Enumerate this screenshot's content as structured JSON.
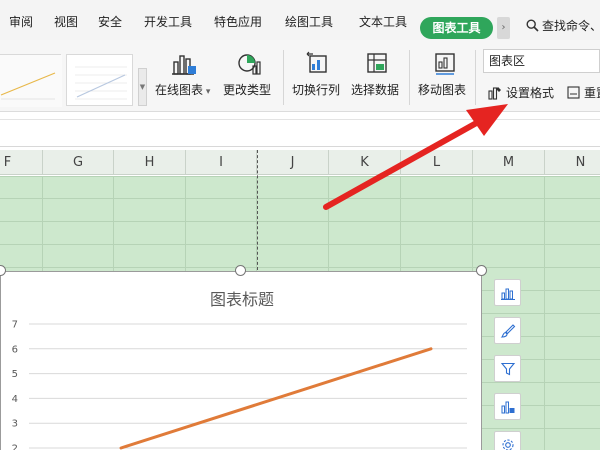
{
  "menu": {
    "tabs": [
      "审阅",
      "视图",
      "安全",
      "开发工具",
      "特色应用",
      "绘图工具",
      "文本工具"
    ],
    "active_tab": "图表工具",
    "search": "查找命令、"
  },
  "ribbon": {
    "online_chart": "在线图表",
    "change_type": "更改类型",
    "switch_row_col": "切换行列",
    "select_data": "选择数据",
    "move_chart": "移动图表",
    "chart_element_select": "图表区",
    "set_format": "设置格式",
    "reset": "重置"
  },
  "sheet": {
    "columns": [
      "F",
      "G",
      "H",
      "I",
      "J",
      "K",
      "L",
      "M",
      "N"
    ]
  },
  "chart": {
    "title": "图表标题"
  },
  "chart_data": {
    "type": "line",
    "title": "图表标题",
    "y_tick_labels": [
      "2",
      "3",
      "4",
      "5",
      "6",
      "7"
    ],
    "ylim": [
      2,
      7
    ],
    "grid": true,
    "series": [
      {
        "color": "#e07b39",
        "x": [
          0,
          1
        ],
        "values": [
          2.0,
          6.0
        ]
      }
    ]
  },
  "colors": {
    "active_tab": "#2fa65b",
    "sheet_fill": "#cde8cd",
    "series_line": "#e07b39",
    "annotation_arrow": "#e52421"
  },
  "icons": {
    "search": "search-icon",
    "chart_elements": "chart-elements-icon",
    "chart_style": "brush-icon",
    "chart_filter": "filter-icon",
    "online_chart_tool": "online-chart-icon",
    "settings": "gear-icon"
  }
}
